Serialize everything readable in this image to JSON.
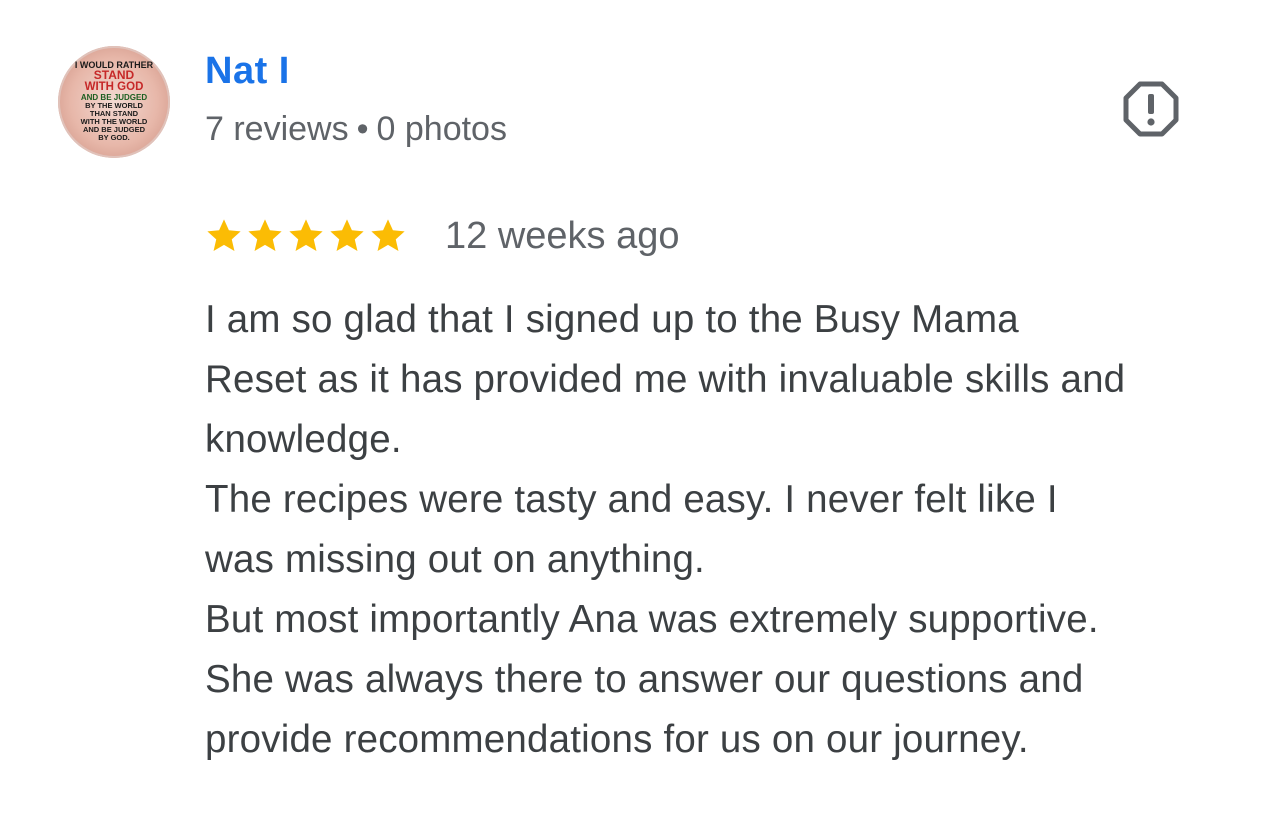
{
  "author": {
    "name": "Nat I",
    "reviews": "7 reviews",
    "separator": "•",
    "photos": "0 photos",
    "avatar_text": [
      "I WOULD RATHER",
      "STAND",
      "WITH GOD",
      "AND BE JUDGED",
      "BY THE WORLD",
      "THAN STAND",
      "WITH THE WORLD",
      "AND BE JUDGED",
      "BY GOD."
    ]
  },
  "flag_icon": "report-flag-icon",
  "rating": {
    "stars": 5,
    "max_stars": 5,
    "date": "12 weeks ago"
  },
  "review": {
    "lines": [
      "I am so glad that I signed up to the Busy Mama",
      "Reset as it has provided me with invaluable skills and",
      "knowledge.",
      "The recipes were tasty and easy. I never felt like I",
      "was missing out on anything.",
      "But most importantly Ana was extremely supportive.",
      "She was always there to answer our questions and",
      "provide recommendations for us on our journey."
    ]
  },
  "colors": {
    "name": "#1a73e8",
    "star": "#fbbc04",
    "meta": "#5f6368",
    "body": "#3c4043",
    "avatar_red": "#c62828",
    "avatar_green": "#1b5e20"
  }
}
